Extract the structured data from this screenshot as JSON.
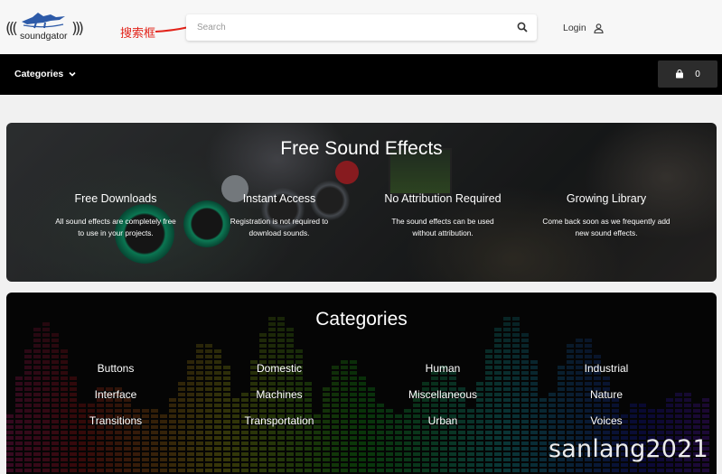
{
  "header": {
    "logo_text": "soundgator",
    "search": {
      "placeholder": "Search",
      "value": ""
    },
    "login_label": "Login"
  },
  "annotation": {
    "label": "搜索框"
  },
  "navbar": {
    "categories_label": "Categories",
    "cart_count": "0"
  },
  "hero": {
    "title": "Free Sound Effects",
    "features": [
      {
        "title": "Free Downloads",
        "line1": "All sound effects are completely free",
        "line2": "to use in your projects."
      },
      {
        "title": "Instant Access",
        "line1": "Registration is not required to",
        "line2": "download sounds."
      },
      {
        "title": "No Attribution Required",
        "line1": "The sound effects can be used",
        "line2": "without attribution."
      },
      {
        "title": "Growing Library",
        "line1": "Come back soon as we frequently add",
        "line2": "new sound effects."
      }
    ]
  },
  "categories": {
    "title": "Categories",
    "items": [
      "Buttons",
      "Domestic",
      "Human",
      "Industrial",
      "Interface",
      "Machines",
      "Miscellaneous",
      "Nature",
      "Transitions",
      "Transportation",
      "Urban",
      "Voices"
    ]
  },
  "watermark": "sanlang2021",
  "colors": {
    "navbar": "#000000",
    "annotation": "#e2231a",
    "cart_button": "#2c2c2c"
  }
}
